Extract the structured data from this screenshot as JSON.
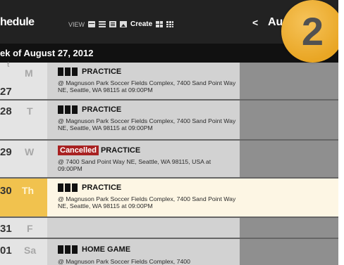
{
  "header": {
    "title": "hedule",
    "view_label": "VIEW",
    "create_label": "Create",
    "prev_glyph": "<",
    "month_label": "Au",
    "week_label": "ek of August 27, 2012"
  },
  "badge": {
    "number": "2",
    "color": "#f0b43c"
  },
  "colors": {
    "cancelled": "#a82121",
    "today": "#f1c24e",
    "today_bg": "#fdf6e4"
  },
  "days": [
    {
      "num": "27",
      "name": "M",
      "head_num": "t",
      "event": {
        "icon": "team-icon",
        "cancelled": "",
        "title": "PRACTICE",
        "location": "@ Magnuson Park Soccer Fields Complex, 7400 Sand Point Way NE, Seattle, WA 98115 at 09:00PM"
      }
    },
    {
      "num": "28",
      "name": "T",
      "event": {
        "icon": "team-icon",
        "cancelled": "",
        "title": "PRACTICE",
        "location": "@ Magnuson Park Soccer Fields Complex, 7400 Sand Point Way NE, Seattle, WA 98115 at 09:00PM"
      }
    },
    {
      "num": "29",
      "name": "W",
      "event": {
        "icon": "",
        "cancelled": "Cancelled",
        "title": "PRACTICE",
        "location": "@ 7400 Sand Point Way NE, Seattle, WA 98115, USA at 09:00PM"
      }
    },
    {
      "num": "30",
      "name": "Th",
      "today": true,
      "event": {
        "icon": "team-icon",
        "cancelled": "",
        "title": "PRACTICE",
        "location": "@ Magnuson Park Soccer Fields Complex, 7400 Sand Point Way NE, Seattle, WA 98115 at 09:00PM"
      }
    },
    {
      "num": "31",
      "name": "F"
    },
    {
      "num": "01",
      "name": "Sa",
      "event": {
        "icon": "team-icon",
        "cancelled": "",
        "title": "HOME GAME",
        "location": "@ Magnuson Park Soccer Fields Complex, 7400"
      }
    }
  ]
}
